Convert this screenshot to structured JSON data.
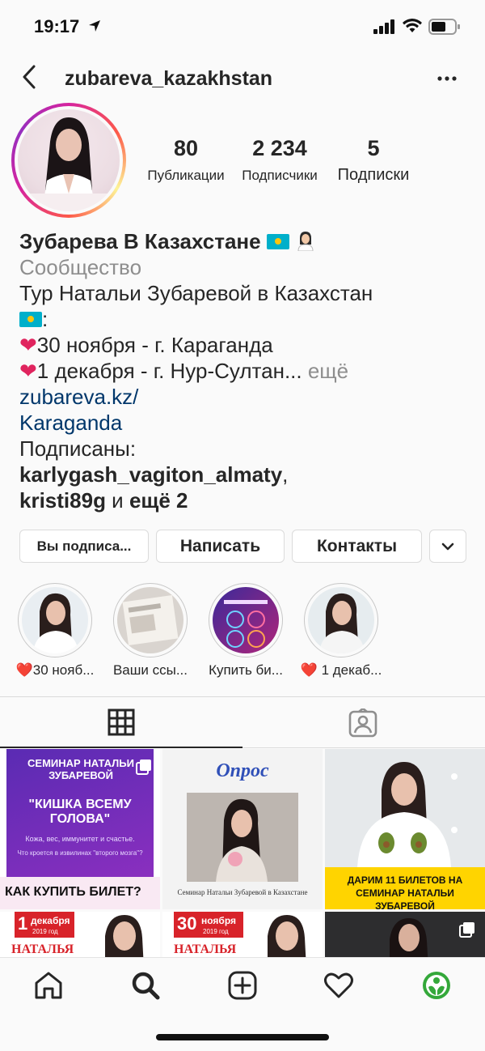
{
  "status_bar": {
    "time": "19:17"
  },
  "header": {
    "username": "zubareva_kazakhstan"
  },
  "profile": {
    "stats": [
      {
        "value": "80",
        "label": "Публикации"
      },
      {
        "value": "2 234",
        "label": "Подписчики"
      },
      {
        "value": "5",
        "label": "Подписки"
      }
    ]
  },
  "bio": {
    "name": "Зубарева В Казахстане",
    "category": "Сообщество",
    "line1": "Тур Натальи Зубаревой в Казахстан",
    "line2_suffix": ":",
    "event1": "30 ноября - г. Караганда",
    "event2": "1 декабря - г. Нур-Султан",
    "ellipsis": "...",
    "more": " ещё",
    "link_line1": "zubareva.kz/",
    "link_line2": "Karaganda",
    "followed_by_label": "Подписаны:",
    "followed_by_user1": "karlygash_vagiton_almaty",
    "comma": ",",
    "followed_by_user2": "kristi89g",
    "and_more_prefix": " и ",
    "and_more": "ещё 2"
  },
  "buttons": {
    "following": "Вы подписа...",
    "message": "Написать",
    "contacts": "Контакты"
  },
  "highlights": [
    {
      "caption": "❤️30 нояб..."
    },
    {
      "caption": "Ваши ссы..."
    },
    {
      "caption": "Купить би..."
    },
    {
      "caption": "❤️ 1 декаб..."
    }
  ],
  "posts": {
    "p1": {
      "title": "СЕМИНАР НАТАЛЬИ ЗУБАРЕВОЙ",
      "headline": "\"КИШКА ВСЕМУ ГОЛОВА\"",
      "sub1": "Кожа, вес, иммунитет и счастье.",
      "sub2": "Что кроется в извилинах \"второго мозга\"?",
      "footer": "КАК КУПИТЬ БИЛЕТ?"
    },
    "p2": {
      "title": "Опрос",
      "footer": "Семинар Натальи Зубаревой в Казахстане"
    },
    "p3": {
      "footer": "ДАРИМ 11 БИЛЕТОВ НА СЕМИНАР НАТАЛЬИ ЗУБАРЕВОЙ"
    },
    "p4": {
      "date_num": "1",
      "date_month": "декабря",
      "year": "2019 год",
      "name": "НАТАЛЬЯ"
    },
    "p5": {
      "date_num": "30",
      "date_month": "ноября",
      "year": "2019 год",
      "name": "НАТАЛЬЯ"
    }
  },
  "colors": {
    "text": "#262626",
    "muted": "#8e8e8e",
    "link": "#00376b",
    "heart": "#e0245e",
    "border": "#dbdbdb",
    "purple_banner": "#6b2fb8",
    "yellow_banner": "#ffd400",
    "red_banner": "#d8232a"
  }
}
